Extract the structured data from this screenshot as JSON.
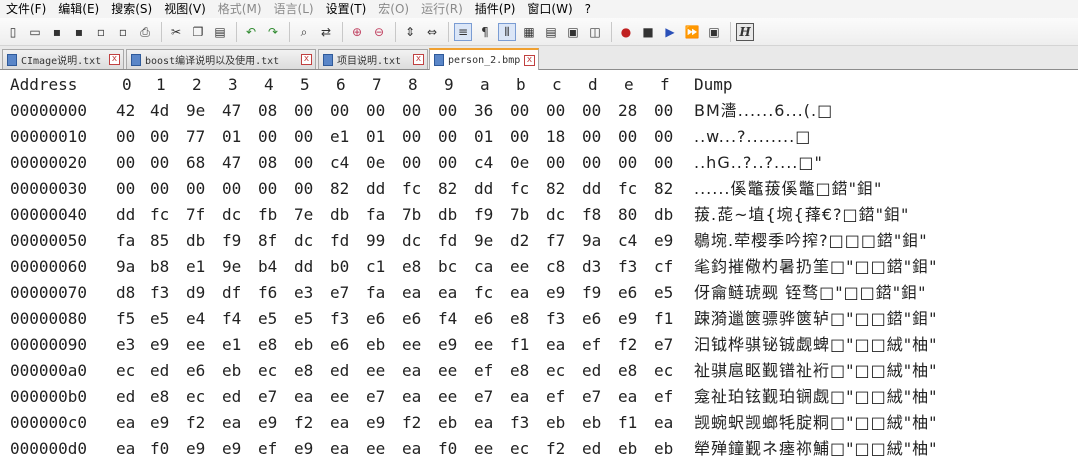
{
  "menu": [
    "文件(F)",
    "编辑(E)",
    "搜索(S)",
    "视图(V)",
    "格式(M)",
    "语言(L)",
    "设置(T)",
    "宏(O)",
    "运行(R)",
    "插件(P)",
    "窗口(W)",
    "?"
  ],
  "menu_disabled": [
    false,
    false,
    false,
    false,
    true,
    true,
    false,
    true,
    true,
    false,
    false,
    false
  ],
  "toolbar_icons": [
    "new-file-icon",
    "open-file-icon",
    "save-icon",
    "save-all-icon",
    "close-icon",
    "close-all-icon",
    "print-icon",
    "sep",
    "cut-icon",
    "copy-icon",
    "paste-icon",
    "sep",
    "undo-icon",
    "redo-icon",
    "sep",
    "find-icon",
    "replace-icon",
    "sep",
    "zoom-in-icon",
    "zoom-out-icon",
    "sep",
    "sync-vertical-icon",
    "sync-horizontal-icon",
    "sep",
    "word-wrap-icon",
    "show-all-chars-icon",
    "indent-guide-icon",
    "document-map-icon",
    "function-list-icon",
    "folder-workspace-icon",
    "monitor-icon",
    "sep",
    "record-macro-icon",
    "stop-record-icon",
    "play-macro-icon",
    "run-macro-multiple-icon",
    "save-macro-icon",
    "sep",
    "hex-editor-icon"
  ],
  "toolbar_glyphs": {
    "new-file-icon": "▯",
    "open-file-icon": "▭",
    "save-icon": "▪",
    "save-all-icon": "▪",
    "close-icon": "▫",
    "close-all-icon": "▫",
    "print-icon": "⎙",
    "cut-icon": "✂",
    "copy-icon": "❐",
    "paste-icon": "▤",
    "undo-icon": "↶",
    "redo-icon": "↷",
    "find-icon": "⌕",
    "replace-icon": "⇄",
    "zoom-in-icon": "⊕",
    "zoom-out-icon": "⊖",
    "sync-vertical-icon": "⇕",
    "sync-horizontal-icon": "⇔",
    "word-wrap-icon": "≡",
    "show-all-chars-icon": "¶",
    "indent-guide-icon": "⫴",
    "document-map-icon": "▦",
    "function-list-icon": "▤",
    "folder-workspace-icon": "▣",
    "monitor-icon": "◫",
    "record-macro-icon": "●",
    "stop-record-icon": "■",
    "play-macro-icon": "▶",
    "run-macro-multiple-icon": "⏩",
    "save-macro-icon": "▣",
    "hex-editor-icon": "H"
  },
  "tabs": [
    {
      "label": "CImage说明.txt",
      "active": false
    },
    {
      "label": "boost编译说明以及使用.txt",
      "active": false
    },
    {
      "label": "项目说明.txt",
      "active": false
    },
    {
      "label": "person_2.bmp",
      "active": true
    }
  ],
  "tab_close_glyph": "x",
  "hex": {
    "header": {
      "address": "Address",
      "cols": [
        "0",
        "1",
        "2",
        "3",
        "4",
        "5",
        "6",
        "7",
        "8",
        "9",
        "a",
        "b",
        "c",
        "d",
        "e",
        "f"
      ],
      "dump": "Dump"
    },
    "rows": [
      {
        "address": "00000000",
        "bytes": [
          "42",
          "4d",
          "9e",
          "47",
          "08",
          "00",
          "00",
          "00",
          "00",
          "00",
          "36",
          "00",
          "00",
          "00",
          "28",
          "00"
        ],
        "dump": "BM瀒......6...(.□"
      },
      {
        "address": "00000010",
        "bytes": [
          "00",
          "00",
          "77",
          "01",
          "00",
          "00",
          "e1",
          "01",
          "00",
          "00",
          "01",
          "00",
          "18",
          "00",
          "00",
          "00"
        ],
        "dump": "..w...?........□"
      },
      {
        "address": "00000020",
        "bytes": [
          "00",
          "00",
          "68",
          "47",
          "08",
          "00",
          "c4",
          "0e",
          "00",
          "00",
          "c4",
          "0e",
          "00",
          "00",
          "00",
          "00"
        ],
        "dump": "..hG..?..?....□\""
      },
      {
        "address": "00000030",
        "bytes": [
          "00",
          "00",
          "00",
          "00",
          "00",
          "00",
          "82",
          "dd",
          "fc",
          "82",
          "dd",
          "fc",
          "82",
          "dd",
          "fc",
          "82"
        ],
        "dump": "......傒鼈菝傒鼈□鍣\"鉬\""
      },
      {
        "address": "00000040",
        "bytes": [
          "dd",
          "fc",
          "7f",
          "dc",
          "fb",
          "7e",
          "db",
          "fa",
          "7b",
          "db",
          "f9",
          "7b",
          "dc",
          "f8",
          "80",
          "db"
        ],
        "dump": "菝.蒊~埴{埦{萚€?□鍣\"鉬\""
      },
      {
        "address": "00000050",
        "bytes": [
          "fa",
          "85",
          "db",
          "f9",
          "8f",
          "dc",
          "fd",
          "99",
          "dc",
          "fd",
          "9e",
          "d2",
          "f7",
          "9a",
          "c4",
          "e9"
        ],
        "dump": "鶡埦.荦樱季吟搾?□□□鍣\"鉬\""
      },
      {
        "address": "00000060",
        "bytes": [
          "9a",
          "b8",
          "e1",
          "9e",
          "b4",
          "dd",
          "b0",
          "c1",
          "e8",
          "bc",
          "ca",
          "ee",
          "c8",
          "d3",
          "f3",
          "cf"
        ],
        "dump": "毟鈞摧儆杓暑扔筀□\"□□鍣\"鉬\""
      },
      {
        "address": "00000070",
        "bytes": [
          "d8",
          "f3",
          "d9",
          "df",
          "f6",
          "e3",
          "e7",
          "fa",
          "ea",
          "ea",
          "fc",
          "ea",
          "e9",
          "f9",
          "e6",
          "e5"
        ],
        "dump": "伢龠鲢琥觋  铚骛□\"□□鍣\"鉬\""
      },
      {
        "address": "00000080",
        "bytes": [
          "f5",
          "e5",
          "e4",
          "f4",
          "e5",
          "e5",
          "f3",
          "e6",
          "e6",
          "f4",
          "e6",
          "e8",
          "f3",
          "e6",
          "e9",
          "f1"
        ],
        "dump": "踈漪邋篋骠骅篋轳□\"□□鍣\"鉬\""
      },
      {
        "address": "00000090",
        "bytes": [
          "e3",
          "e9",
          "ee",
          "e1",
          "e8",
          "eb",
          "e6",
          "eb",
          "ee",
          "e9",
          "ee",
          "f1",
          "ea",
          "ef",
          "f2",
          "e7"
        ],
        "dump": "汩钺桦骐铋铖觑蜱□\"□□絨\"柚\""
      },
      {
        "address": "000000a0",
        "bytes": [
          "ec",
          "ed",
          "e6",
          "eb",
          "ec",
          "e8",
          "ed",
          "ee",
          "ea",
          "ee",
          "ef",
          "e8",
          "ec",
          "ed",
          "e8",
          "ec"
        ],
        "dump": "祉骐扈眍觐镨祉裄□\"□□絨\"柚\""
      },
      {
        "address": "000000b0",
        "bytes": [
          "ed",
          "e8",
          "ec",
          "ed",
          "e7",
          "ea",
          "ee",
          "e7",
          "ea",
          "ee",
          "e7",
          "ea",
          "ef",
          "e7",
          "ea",
          "ef"
        ],
        "dump": "龛祉珀铉觐珀锎觑□\"□□絨\"柚\""
      },
      {
        "address": "000000c0",
        "bytes": [
          "ea",
          "e9",
          "f2",
          "ea",
          "e9",
          "f2",
          "ea",
          "e9",
          "f2",
          "eb",
          "ea",
          "f3",
          "eb",
          "eb",
          "f1",
          "ea"
        ],
        "dump": "觊蜿蚇觊螂牦腚粡□\"□□絨\"柚\""
      },
      {
        "address": "000000d0",
        "bytes": [
          "ea",
          "f0",
          "e9",
          "e9",
          "ef",
          "e9",
          "ea",
          "ee",
          "ea",
          "f0",
          "ee",
          "ec",
          "f2",
          "ed",
          "eb",
          "eb"
        ],
        "dump": "犖殚鐘觐ネ瘗祢鯆□\"□□絨\"柚\""
      }
    ]
  }
}
